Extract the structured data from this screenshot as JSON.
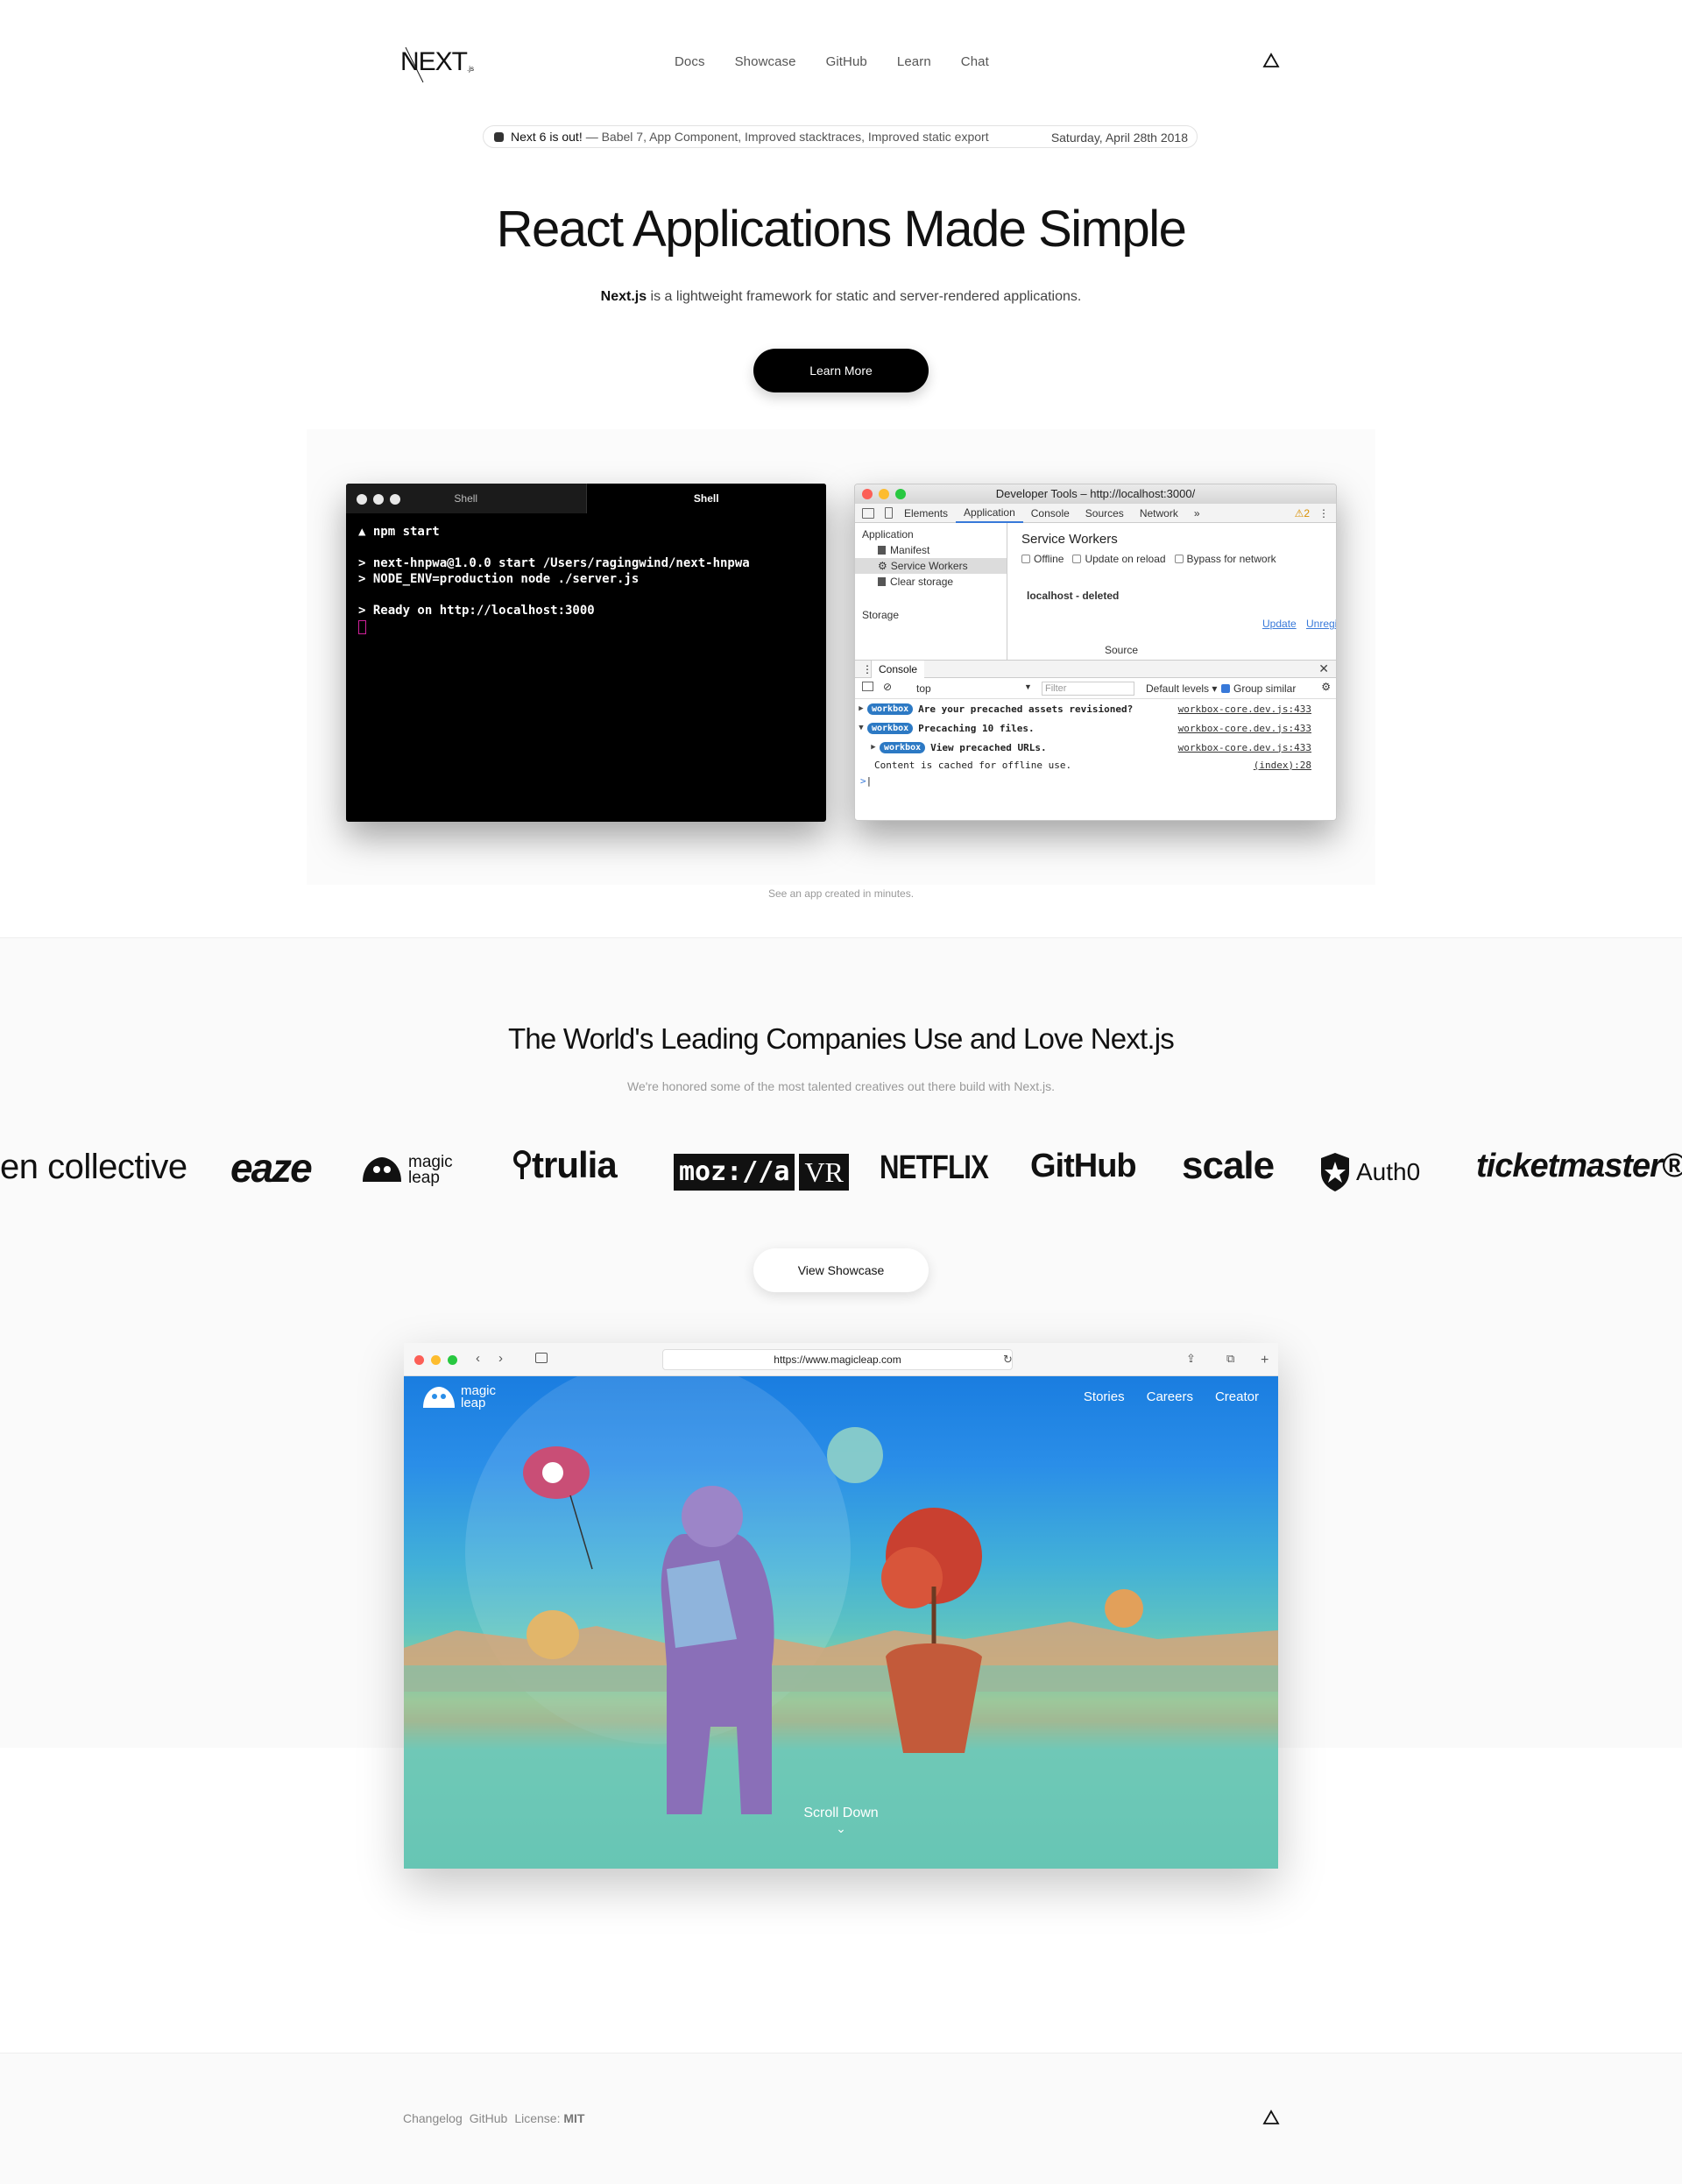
{
  "header": {
    "logo_text": "NEXT.js",
    "nav": [
      "Docs",
      "Showcase",
      "GitHub",
      "Learn",
      "Chat"
    ],
    "right_icon": "triangle-icon"
  },
  "announcement": {
    "headline": "Next 6 is out!",
    "details": "— Babel 7, App Component, Improved stacktraces, Improved static export",
    "date": "Saturday, April 28th 2018"
  },
  "hero": {
    "title": "React Applications Made Simple",
    "subtitle_strong": "Next.js",
    "subtitle_rest": " is a lightweight framework for static and server-rendered applications.",
    "button": "Learn More"
  },
  "terminal": {
    "tabs": [
      "Shell",
      "Shell"
    ],
    "lines": [
      "▲ npm start",
      "",
      "> next-hnpwa@1.0.0 start /Users/ragingwind/next-hnpwa",
      "> NODE_ENV=production node ./server.js",
      "",
      "> Ready on http://localhost:3000"
    ]
  },
  "devtools": {
    "title": "Developer Tools – http://localhost:3000/",
    "tabs": [
      "Elements",
      "Application",
      "Console",
      "Sources",
      "Network",
      "»"
    ],
    "active_tab": "Application",
    "warnings": "⚠2",
    "sidebar": {
      "section1": "Application",
      "items": [
        "Manifest",
        "Service Workers",
        "Clear storage"
      ],
      "section2": "Storage"
    },
    "main": {
      "heading": "Service Workers",
      "checks": [
        "Offline",
        "Update on reload",
        "Bypass for network"
      ],
      "host": "localhost - deleted",
      "update": "Update",
      "unregister": "Unregiste",
      "source": "Source"
    },
    "console": {
      "label": "Console",
      "context": "top",
      "filter_placeholder": "Filter",
      "levels": "Default levels ▾",
      "group_similar": "Group similar",
      "logs": [
        {
          "badge": "workbox",
          "text": "Are your precached assets revisioned?",
          "ref": "workbox-core.dev.js:433"
        },
        {
          "badge": "workbox",
          "text": "Precaching 10 files.",
          "ref": "workbox-core.dev.js:433"
        },
        {
          "badge": "workbox",
          "text": "View precached URLs.",
          "ref": "workbox-core.dev.js:433"
        },
        {
          "badge": "",
          "text": "Content is cached for offline use.",
          "ref": "(index):28"
        }
      ]
    }
  },
  "demo_caption": "See an app created in minutes.",
  "companies": {
    "title": "The World's Leading Companies Use and Love Next.js",
    "subtitle": "We're honored some of the most talented creatives out there build with Next.js.",
    "logos": [
      "en collective",
      "eaze",
      "magic leap",
      "trulia",
      "moz://a",
      "VR",
      "NETFLIX",
      "GitHub",
      "scale",
      "Auth0",
      "ticketmaster®"
    ],
    "button": "View Showcase"
  },
  "browser": {
    "url": "https://www.magicleap.com",
    "site_logo": "magic leap",
    "site_nav": [
      "Stories",
      "Careers",
      "Creator"
    ],
    "scroll_text": "Scroll Down"
  },
  "footer": {
    "links": [
      "Changelog",
      "GitHub"
    ],
    "license_label": "License:",
    "license_value": "MIT"
  }
}
